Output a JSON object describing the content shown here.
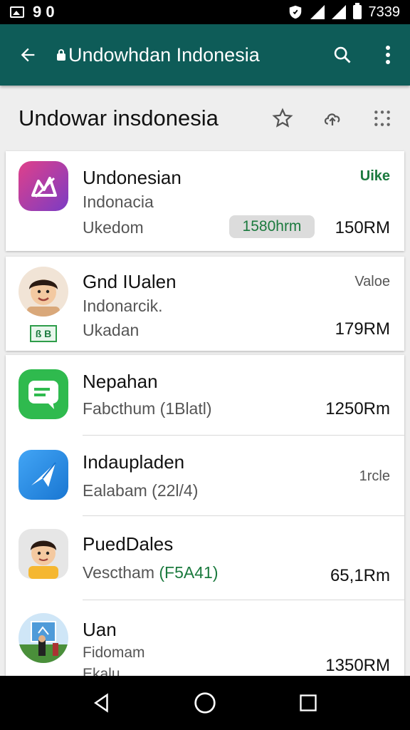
{
  "status_bar": {
    "time_left": "9 0",
    "time_right": "7339"
  },
  "app_bar": {
    "title": "Undowhdan Indonesia"
  },
  "page": {
    "title": "Undowar insdonesia"
  },
  "items": [
    {
      "name": "Undonesian",
      "line1": "Indonacia",
      "line2": "Ukedom",
      "badge": "Uike",
      "pill": "1580hrm",
      "price": "150RM",
      "icon_color": "#a23bb0"
    },
    {
      "name": "Gnd IUalen",
      "line1": "Indonarcik.",
      "line2": "Ukadan",
      "badge": "Valoe",
      "price": "179RM",
      "small_tag": "ß B"
    },
    {
      "name": "Nepahan",
      "line1": "Fabcthum (1Blatl)",
      "price": "1250Rm",
      "icon_color": "#2fba4e"
    },
    {
      "name": "Indaupladen",
      "line1": "Ealabam (22l/4)",
      "badge": "1rcle",
      "icon_color": "#2196f3"
    },
    {
      "name": "PuedDales",
      "line1_prefix": "Vesctham",
      "line1_green": "(F5A41)",
      "price": "65,1Rm"
    },
    {
      "name": "Uan",
      "line1": "Fidomam",
      "line2": "Ekalu",
      "price": "1350RM"
    }
  ],
  "colors": {
    "app_bar": "#0e5c58",
    "green": "#1b7a3e"
  }
}
